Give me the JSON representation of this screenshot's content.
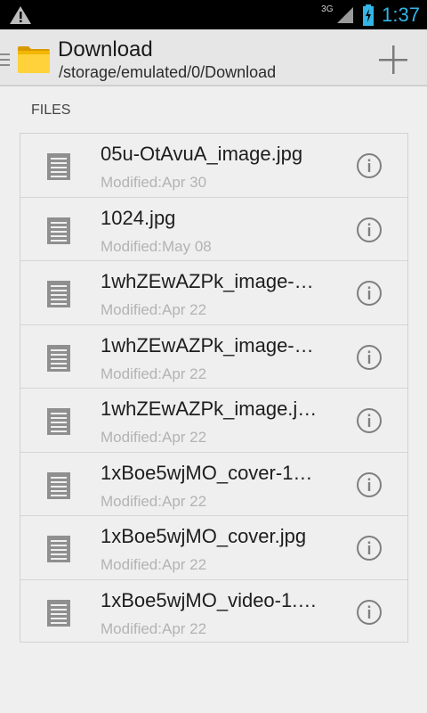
{
  "status_bar": {
    "network_type": "3G",
    "time": "1:37",
    "icons": [
      "warning-icon",
      "signal-icon",
      "battery-charging-icon"
    ]
  },
  "action_bar": {
    "title": "Download",
    "path": "/storage/emulated/0/Download",
    "icons": [
      "drawer-icon",
      "folder-icon",
      "add-icon"
    ]
  },
  "section": {
    "label": "FILES"
  },
  "files": [
    {
      "name": "05u-OtAvuA_image.jpg",
      "modified": "Modified:Apr 30"
    },
    {
      "name": "1024.jpg",
      "modified": "Modified:May 08"
    },
    {
      "name": "1whZEwAZPk_image-…",
      "modified": "Modified:Apr 22"
    },
    {
      "name": "1whZEwAZPk_image-…",
      "modified": "Modified:Apr 22"
    },
    {
      "name": "1whZEwAZPk_image.j…",
      "modified": "Modified:Apr 22"
    },
    {
      "name": "1xBoe5wjMO_cover-1…",
      "modified": "Modified:Apr 22"
    },
    {
      "name": "1xBoe5wjMO_cover.jpg",
      "modified": "Modified:Apr 22"
    },
    {
      "name": "1xBoe5wjMO_video-1.…",
      "modified": "Modified:Apr 22"
    }
  ],
  "colors": {
    "accent": "#33b5e5",
    "folder": "#f2b705"
  }
}
